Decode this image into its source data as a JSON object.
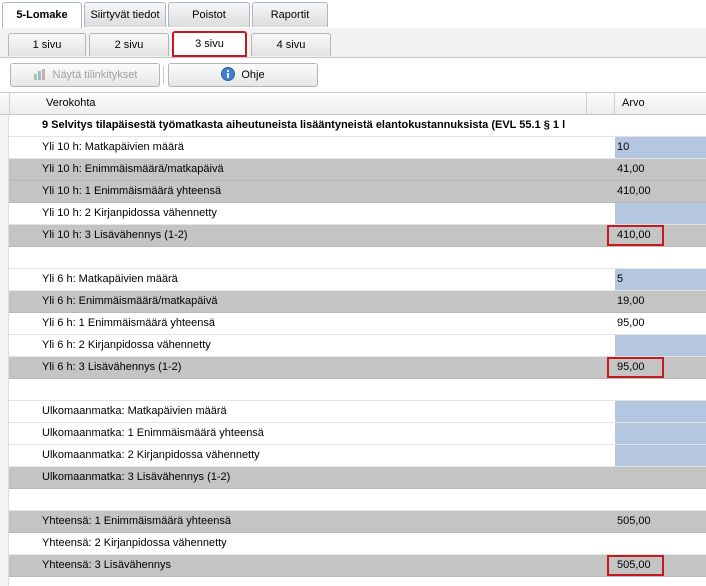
{
  "main_tabs": [
    {
      "label": "5-Lomake",
      "active": true
    },
    {
      "label": "Siirtyvät tiedot",
      "active": false
    },
    {
      "label": "Poistot",
      "active": false
    },
    {
      "label": "Raportit",
      "active": false
    }
  ],
  "sub_tabs": [
    {
      "label": "1 sivu",
      "active": false
    },
    {
      "label": "2 sivu",
      "active": false
    },
    {
      "label": "3 sivu",
      "active": true
    },
    {
      "label": "4 sivu",
      "active": false
    }
  ],
  "toolbar": {
    "show_accounts_label": "Näytä tilinkitykset",
    "help_label": "Ohje",
    "help_icon": "info-icon",
    "accounts_icon": "chart-icon"
  },
  "grid": {
    "col_item": "Verokohta",
    "col_value": "Arvo",
    "rows": [
      {
        "label": "9 Selvitys tilapäisestä työmatkasta aiheutuneista lisääntyneistä elantokustannuksista (EVL 55.1 § 1 l",
        "value": "",
        "style": "section",
        "cell": ""
      },
      {
        "label": "Yli 10 h: Matkapäivien määrä",
        "value": "10",
        "style": "white",
        "cell": "blue"
      },
      {
        "label": "Yli 10 h: Enimmäismäärä/matkapäivä",
        "value": "41,00",
        "style": "gray",
        "cell": ""
      },
      {
        "label": "Yli 10 h: 1 Enimmäismäärä yhteensä",
        "value": "410,00",
        "style": "gray",
        "cell": ""
      },
      {
        "label": "Yli 10 h: 2 Kirjanpidossa vähennetty",
        "value": "",
        "style": "white",
        "cell": "blue"
      },
      {
        "label": "Yli 10 h: 3 Lisävähennys (1-2)",
        "value": "410,00",
        "style": "gray",
        "cell": "red"
      },
      {
        "label": "",
        "value": "",
        "style": "white",
        "cell": ""
      },
      {
        "label": "Yli 6 h: Matkapäivien määrä",
        "value": "5",
        "style": "white",
        "cell": "blue"
      },
      {
        "label": "Yli 6 h: Enimmäismäärä/matkapäivä",
        "value": "19,00",
        "style": "gray",
        "cell": ""
      },
      {
        "label": "Yli 6 h: 1 Enimmäismäärä yhteensä",
        "value": "95,00",
        "style": "white",
        "cell": ""
      },
      {
        "label": "Yli 6 h: 2 Kirjanpidossa vähennetty",
        "value": "",
        "style": "white",
        "cell": "blue"
      },
      {
        "label": "Yli 6 h: 3 Lisävähennys (1-2)",
        "value": "95,00",
        "style": "gray",
        "cell": "red"
      },
      {
        "label": "",
        "value": "",
        "style": "white",
        "cell": ""
      },
      {
        "label": "Ulkomaanmatka: Matkapäivien määrä",
        "value": "",
        "style": "white",
        "cell": "blue"
      },
      {
        "label": "Ulkomaanmatka: 1 Enimmäismäärä yhteensä",
        "value": "",
        "style": "white",
        "cell": "blue"
      },
      {
        "label": "Ulkomaanmatka: 2 Kirjanpidossa vähennetty",
        "value": "",
        "style": "white",
        "cell": "blue"
      },
      {
        "label": "Ulkomaanmatka: 3 Lisävähennys (1-2)",
        "value": "",
        "style": "gray",
        "cell": ""
      },
      {
        "label": "",
        "value": "",
        "style": "white",
        "cell": ""
      },
      {
        "label": "Yhteensä: 1 Enimmäismäärä yhteensä",
        "value": "505,00",
        "style": "gray",
        "cell": ""
      },
      {
        "label": "Yhteensä: 2 Kirjanpidossa vähennetty",
        "value": "",
        "style": "white",
        "cell": ""
      },
      {
        "label": "Yhteensä: 3 Lisävähennys",
        "value": "505,00",
        "style": "gray",
        "cell": "red"
      }
    ]
  }
}
